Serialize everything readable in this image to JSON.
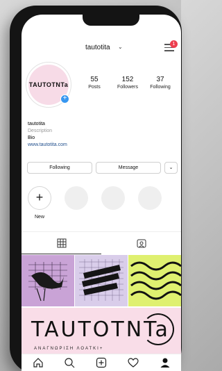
{
  "header": {
    "username": "tautotita",
    "chevron_icon": "chevron-down-icon",
    "menu_icon": "hamburger-menu-icon",
    "notification_count": "1"
  },
  "profile": {
    "avatar_text": "TAUTOTNTa",
    "add_icon": "plus-icon",
    "stats": [
      {
        "value": "55",
        "label": "Posts"
      },
      {
        "value": "152",
        "label": "Followers"
      },
      {
        "value": "37",
        "label": "Following"
      }
    ],
    "name": "tautotita",
    "description": "Description",
    "bio": "Bio",
    "website": "www.tautotita.com"
  },
  "actions": {
    "following_label": "Following",
    "message_label": "Message",
    "dropdown_icon": "chevron-down-icon"
  },
  "highlights": {
    "new_label": "New",
    "new_icon": "plus-icon"
  },
  "tabs": [
    {
      "icon": "grid-icon"
    },
    {
      "icon": "tagged-person-icon"
    }
  ],
  "banner": {
    "title": "TAUTOTNTa",
    "subtitle": "ΑΝΑΓΝΩΡΙΣΗ ΛΟΑΤΚΙ+"
  },
  "bottom_nav": [
    {
      "icon": "home-icon"
    },
    {
      "icon": "search-icon"
    },
    {
      "icon": "add-post-icon"
    },
    {
      "icon": "heart-icon"
    },
    {
      "icon": "profile-icon"
    }
  ],
  "colors": {
    "avatar_bg": "#f7dbe7",
    "accent_blue": "#3797f0",
    "badge_red": "#ed3f4f",
    "tile_purple": "#c9a3d6",
    "tile_lavender": "#d9cdea",
    "tile_lime": "#dff070",
    "banner_pink": "#f9dde8"
  }
}
